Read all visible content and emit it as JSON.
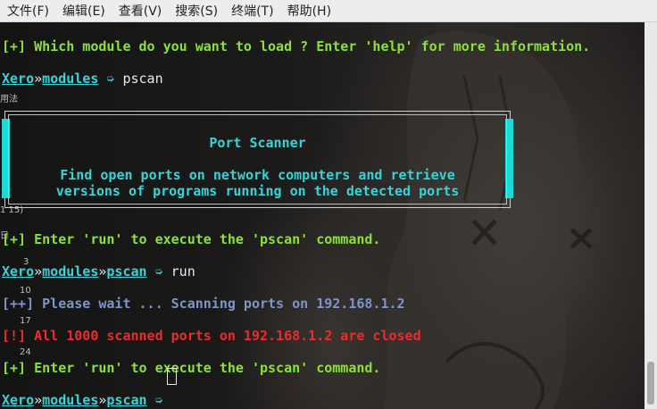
{
  "menu": [
    "文件(F)",
    "编辑(E)",
    "查看(V)",
    "搜索(S)",
    "终端(T)",
    "帮助(H)"
  ],
  "terminal": {
    "module_prompt": "[+] Which module do you want to load ? Enter 'help' for more information.",
    "user": "Xero",
    "sep": "»",
    "path1": "modules",
    "path2": "pscan",
    "arrow": "➭",
    "cmd1": "pscan",
    "cmd2": "run",
    "box_title": "Port Scanner",
    "box_line1": "Find open ports on network computers and retrieve",
    "box_line2": "versions of programs running on the detected ports",
    "run_hint": "[+] Enter 'run' to execute the 'pscan' command.",
    "wait_msg": "[++] Please wait ... Scanning ports on 192.168.1.2",
    "closed_msg": "[!] All 1000 scanned ports on 192.168.1.2 are closed",
    "run_hint2": "[+] Enter 'run' to execute the 'pscan' command."
  },
  "background_text": [
    "用法",
    "1 15)",
    "日",
    "3",
    "10",
    "17",
    "24"
  ],
  "colors": {
    "green": "#8ae234",
    "teal": "#34d4d8",
    "blue": "#7e95c9",
    "red": "#ee2a2a"
  }
}
